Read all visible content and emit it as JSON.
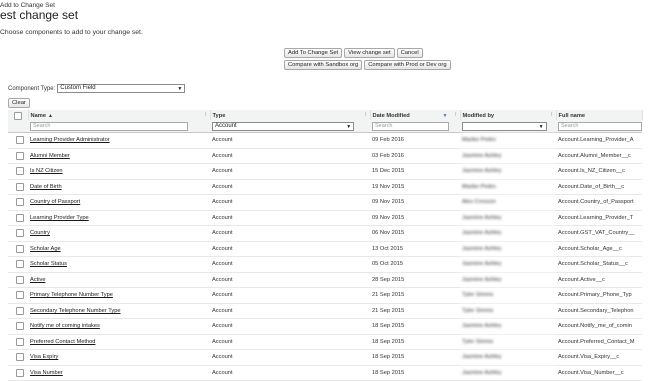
{
  "header": {
    "breadcrumb": "Add to Change Set",
    "title": "est change set",
    "subtitle": "Choose components to add to your change set."
  },
  "buttons": {
    "add": "Add To Change Set",
    "view": "View change set",
    "cancel": "Cancel",
    "compare_sandbox": "Compare with Sandbox org",
    "compare_prod": "Compare with Prod or Dev org"
  },
  "component_type": {
    "label": "Component Type:",
    "value": "Custom Field"
  },
  "clear_label": "Clear",
  "table": {
    "columns": {
      "name": "Name",
      "type": "Type",
      "date": "Date Modified",
      "modified_by": "Modified by",
      "full_name": "Full name"
    },
    "filters": {
      "name_placeholder": "Search",
      "type_value": "Account",
      "date_placeholder": "Search",
      "modified_by_value": "",
      "full_name_placeholder": "Search"
    },
    "rows": [
      {
        "name": "Learning Provider Administrator",
        "type": "Account",
        "date": "09 Feb 2016",
        "by": "Marike Pedro",
        "full": "Account.Learning_Provider_A"
      },
      {
        "name": "Alumni Member",
        "type": "Account",
        "date": "03 Feb 2016",
        "by": "Jasmine Ashley",
        "full": "Account.Alumni_Member__c"
      },
      {
        "name": "Is NZ Citizen",
        "type": "Account",
        "date": "15 Dec 2015",
        "by": "Jasmine Ashley",
        "full": "Account.Is_NZ_Citizen__c"
      },
      {
        "name": "Date of Birth",
        "type": "Account",
        "date": "19 Nov 2015",
        "by": "Marike Pedro",
        "full": "Account.Date_of_Birth__c"
      },
      {
        "name": "Country of Passport",
        "type": "Account",
        "date": "09 Nov 2015",
        "by": "Alex Cresson",
        "full": "Account.Country_of_Passport"
      },
      {
        "name": "Learning Provider Type",
        "type": "Account",
        "date": "09 Nov 2015",
        "by": "Jasmine Ashley",
        "full": "Account.Learning_Provider_T"
      },
      {
        "name": "Country",
        "type": "Account",
        "date": "06 Nov 2015",
        "by": "Jasmine Ashley",
        "full": "Account.GST_VAT_Country__"
      },
      {
        "name": "Scholar Age",
        "type": "Account",
        "date": "13 Oct 2015",
        "by": "Jasmine Ashley",
        "full": "Account.Scholar_Age__c"
      },
      {
        "name": "Scholar Status",
        "type": "Account",
        "date": "05 Oct 2015",
        "by": "Jasmine Ashley",
        "full": "Account.Scholar_Status__c"
      },
      {
        "name": "Active",
        "type": "Account",
        "date": "28 Sep 2015",
        "by": "Jasmine Ashley",
        "full": "Account.Active__c"
      },
      {
        "name": "Primary Telephone Number Type",
        "type": "Account",
        "date": "21 Sep 2015",
        "by": "Tyler Simms",
        "full": "Account.Primary_Phone_Typ"
      },
      {
        "name": "Secondary Telephone Number Type",
        "type": "Account",
        "date": "21 Sep 2015",
        "by": "Tyler Simms",
        "full": "Account.Secondary_Telephon"
      },
      {
        "name": "Notify me of coming intakes",
        "type": "Account",
        "date": "18 Sep 2015",
        "by": "Jasmine Ashley",
        "full": "Account.Notify_me_of_comin"
      },
      {
        "name": "Preferred Contact Method",
        "type": "Account",
        "date": "18 Sep 2015",
        "by": "Tyler Simms",
        "full": "Account.Preferred_Contact_M"
      },
      {
        "name": "Visa Expiry",
        "type": "Account",
        "date": "18 Sep 2015",
        "by": "Jasmine Ashley",
        "full": "Account.Visa_Expiry__c"
      },
      {
        "name": "Visa Number",
        "type": "Account",
        "date": "18 Sep 2015",
        "by": "Jasmine Ashley",
        "full": "Account.Visa_Number__c"
      }
    ]
  }
}
